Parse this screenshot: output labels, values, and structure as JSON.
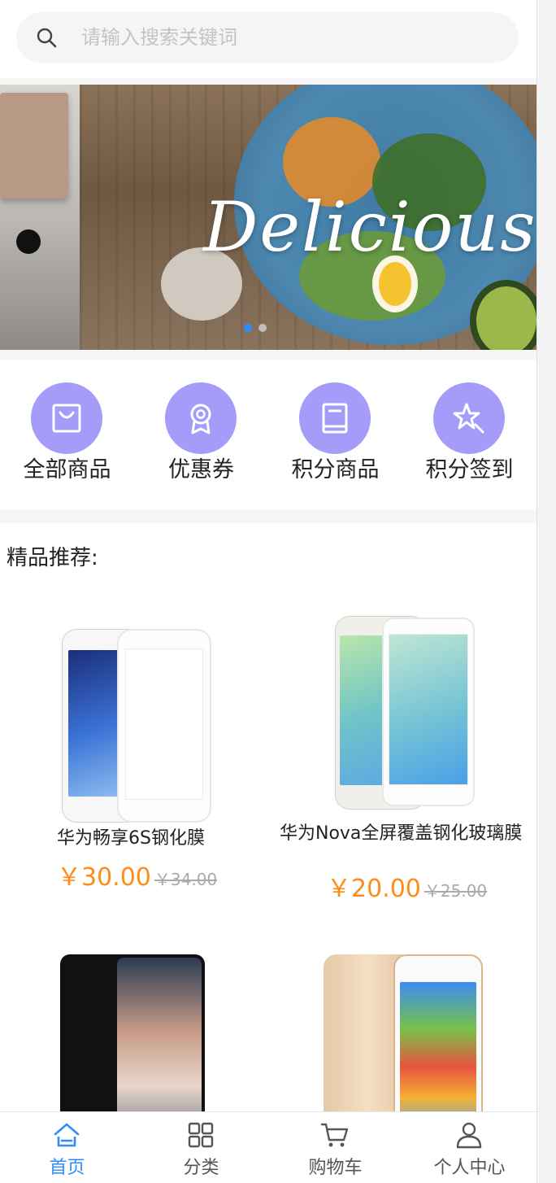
{
  "search": {
    "placeholder": "请输入搜索关键词"
  },
  "banner": {
    "text": "Delicious",
    "dots": [
      true,
      false
    ]
  },
  "quick_nav": [
    {
      "label": "全部商品",
      "icon": "bag-icon"
    },
    {
      "label": "优惠券",
      "icon": "award-icon"
    },
    {
      "label": "积分商品",
      "icon": "book-icon"
    },
    {
      "label": "积分签到",
      "icon": "star-sparkle-icon"
    }
  ],
  "recommend": {
    "title": "精品推荐:",
    "products": [
      {
        "name": "华为畅享6S钢化膜",
        "price": "￥30.00",
        "old_price": "￥34.00"
      },
      {
        "name": "华为Nova全屏覆盖钢化玻璃膜",
        "price": "￥20.00",
        "old_price": "￥25.00"
      },
      {
        "name": "",
        "price": "",
        "old_price": ""
      },
      {
        "name": "",
        "price": "",
        "old_price": ""
      }
    ]
  },
  "tabbar": [
    {
      "label": "首页",
      "icon": "home-icon",
      "active": true
    },
    {
      "label": "分类",
      "icon": "grid-icon",
      "active": false
    },
    {
      "label": "购物车",
      "icon": "cart-icon",
      "active": false
    },
    {
      "label": "个人中心",
      "icon": "user-icon",
      "active": false
    }
  ],
  "colors": {
    "accent": "#2f8cff",
    "price": "#ff8c1a",
    "nav_circle": "#a59cfa"
  }
}
